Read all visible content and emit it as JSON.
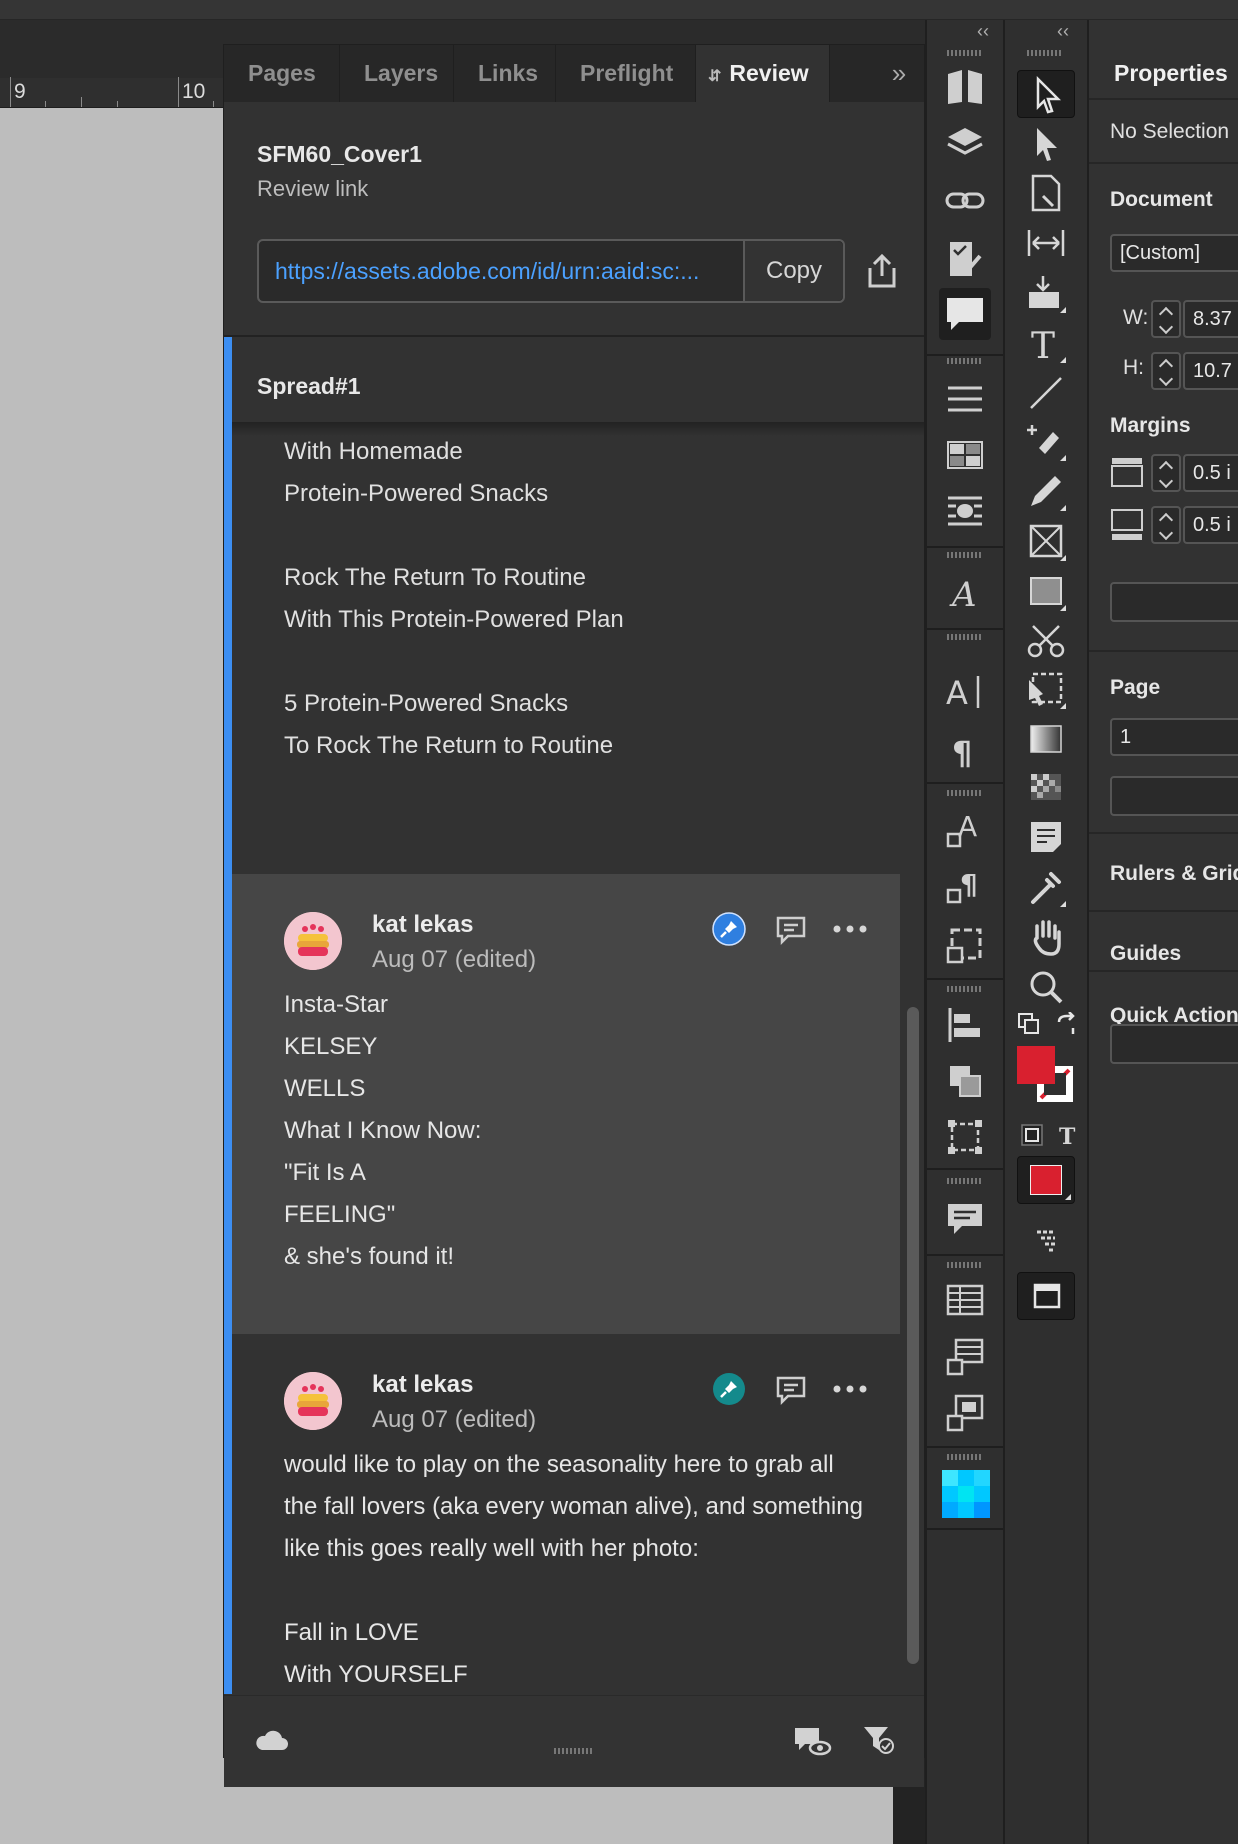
{
  "ruler": {
    "mark_9": "9",
    "mark_10": "10"
  },
  "panel": {
    "tabs": [
      {
        "label": "Pages"
      },
      {
        "label": "Layers"
      },
      {
        "label": "Links"
      },
      {
        "label": "Preflight"
      },
      {
        "label": "Review",
        "active": true
      }
    ],
    "more": "»",
    "document_title": "SFM60_Cover1",
    "review_link_label": "Review link",
    "review_url": "https://assets.adobe.com/id/urn:aaid:sc:...",
    "copy_label": "Copy",
    "spread_label": "Spread#1",
    "spread_text": [
      "With Homemade",
      "Protein-Powered Snacks",
      "",
      "Rock The Return To Routine",
      "With This Protein-Powered Plan",
      "",
      "5 Protein-Powered Snacks",
      "To Rock The Return to Routine"
    ],
    "comments": [
      {
        "author": "kat lekas",
        "date": "Aug 07 (edited)",
        "pin_color": "#2f7fe0",
        "lines": [
          "Insta-Star",
          "KELSEY",
          "WELLS",
          "What I Know Now:",
          "\"Fit Is A",
          "FEELING\"",
          "& she's found it!"
        ]
      },
      {
        "author": "kat lekas",
        "date": "Aug 07 (edited)",
        "pin_color": "#148a8c",
        "lines": [
          "would like to play on the seasonality here to grab all",
          "the fall lovers (aka every woman alive), and something",
          "like this goes really well with her photo:",
          "",
          "Fall in LOVE",
          "With YOURSELF"
        ]
      }
    ]
  },
  "properties": {
    "title": "Properties",
    "selection": "No Selection",
    "document_heading": "Document",
    "preset": "[Custom]",
    "w_label": "W:",
    "w_value": "8.37",
    "h_label": "H:",
    "h_value": "10.7",
    "margins_heading": "Margins",
    "margin_top": "0.5 i",
    "margin_bottom": "0.5 i",
    "page_heading": "Page",
    "page_value": "1",
    "rulers_heading": "Rulers & Grid",
    "guides_heading": "Guides",
    "quick_actions_heading": "Quick Actions"
  },
  "colors": {
    "accent_blue": "#3c8ef2",
    "link_blue": "#4ba1ff",
    "fill_red": "#d9202f"
  },
  "icons": {
    "panel_strip": [
      "pages-icon",
      "layers-icon",
      "links-icon",
      "preflight-icon",
      "review-comment-icon",
      "stroke-icon",
      "swatches-icon",
      "text-wrap-icon",
      "glyphs-icon",
      "character-icon",
      "paragraph-icon",
      "character-styles-icon",
      "paragraph-styles-icon",
      "object-styles-icon",
      "align-icon",
      "pathfinder-icon",
      "transform-icon",
      "comments-icon",
      "table-icon",
      "table-styles-icon",
      "cell-styles-icon",
      "color-theme-icon"
    ],
    "tools": [
      "selection-tool-icon",
      "direct-selection-tool-icon",
      "page-tool-icon",
      "gap-tool-icon",
      "content-collector-icon",
      "type-tool-icon",
      "line-tool-icon",
      "pen-tool-icon",
      "pencil-tool-icon",
      "rectangle-frame-tool-icon",
      "rectangle-tool-icon",
      "scissors-tool-icon",
      "free-transform-tool-icon",
      "gradient-swatch-tool-icon",
      "gradient-feather-tool-icon",
      "note-tool-icon",
      "eyedropper-tool-icon",
      "hand-tool-icon",
      "zoom-tool-icon"
    ]
  }
}
